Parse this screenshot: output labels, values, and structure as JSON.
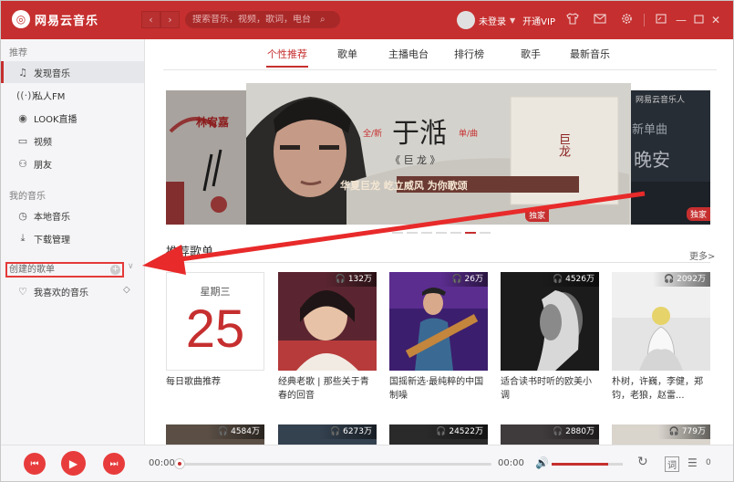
{
  "app": {
    "logo_text": "网易云音乐"
  },
  "titlebar": {
    "search_placeholder": "搜索音乐，视频，歌词，电台",
    "login_text": "未登录",
    "vip_text": "开通VIP"
  },
  "sidebar": {
    "heading_recommend": "推荐",
    "recommend_items": [
      "发现音乐",
      "私人FM",
      "LOOK直播",
      "视频",
      "朋友"
    ],
    "heading_my_music": "我的音乐",
    "my_music_items": [
      "本地音乐",
      "下载管理"
    ],
    "created_playlists": "创建的歌单",
    "liked_music": "我喜欢的音乐"
  },
  "tabs": [
    "个性推荐",
    "歌单",
    "主播电台",
    "排行榜",
    "歌手",
    "最新音乐"
  ],
  "banner": {
    "center_tag_left": "全/新",
    "center_artist": "于湉",
    "center_tag_right": "单/曲",
    "center_song": "《 巨 龙 》",
    "center_slogan": "华夏巨龙 屹立威风 为你歌颂",
    "album_text": "巨龙",
    "left_name": "林宥嘉",
    "right_brand": "网易云音乐人",
    "right_text_1": "新单曲",
    "right_text_2": "晚安",
    "exclusive_badge": "独家"
  },
  "section": {
    "title": "推荐歌单",
    "more": "更多>"
  },
  "daily": {
    "weekday": "星期三",
    "day": "25",
    "title": "每日歌曲推荐"
  },
  "playlists": [
    {
      "plays": "132万",
      "title": "经典老歌 | 那些关于青春的回音"
    },
    {
      "plays": "26万",
      "title": "国摇新选·最纯粹的中国制噪"
    },
    {
      "plays": "4526万",
      "title": "适合读书时听的欧美小调"
    },
    {
      "plays": "2092万",
      "title": "朴树，许巍，李健，郑钧，老狼，赵雷..."
    }
  ],
  "row2_plays": [
    "4584万",
    "6273万",
    "24522万",
    "2880万",
    "779万"
  ],
  "player": {
    "current_time": "00:00",
    "total_time": "00:00",
    "queue_count": "0",
    "lyric_label": "词"
  },
  "icons": {
    "logo": "netease-logo-icon",
    "back": "back-arrow-icon",
    "forward": "forward-arrow-icon",
    "search": "search-icon",
    "skin": "tshirt-icon",
    "mail": "mail-icon",
    "settings": "gear-icon"
  },
  "colors": {
    "brand_red": "#c62f2f",
    "annotation_red": "#e53a3a"
  }
}
